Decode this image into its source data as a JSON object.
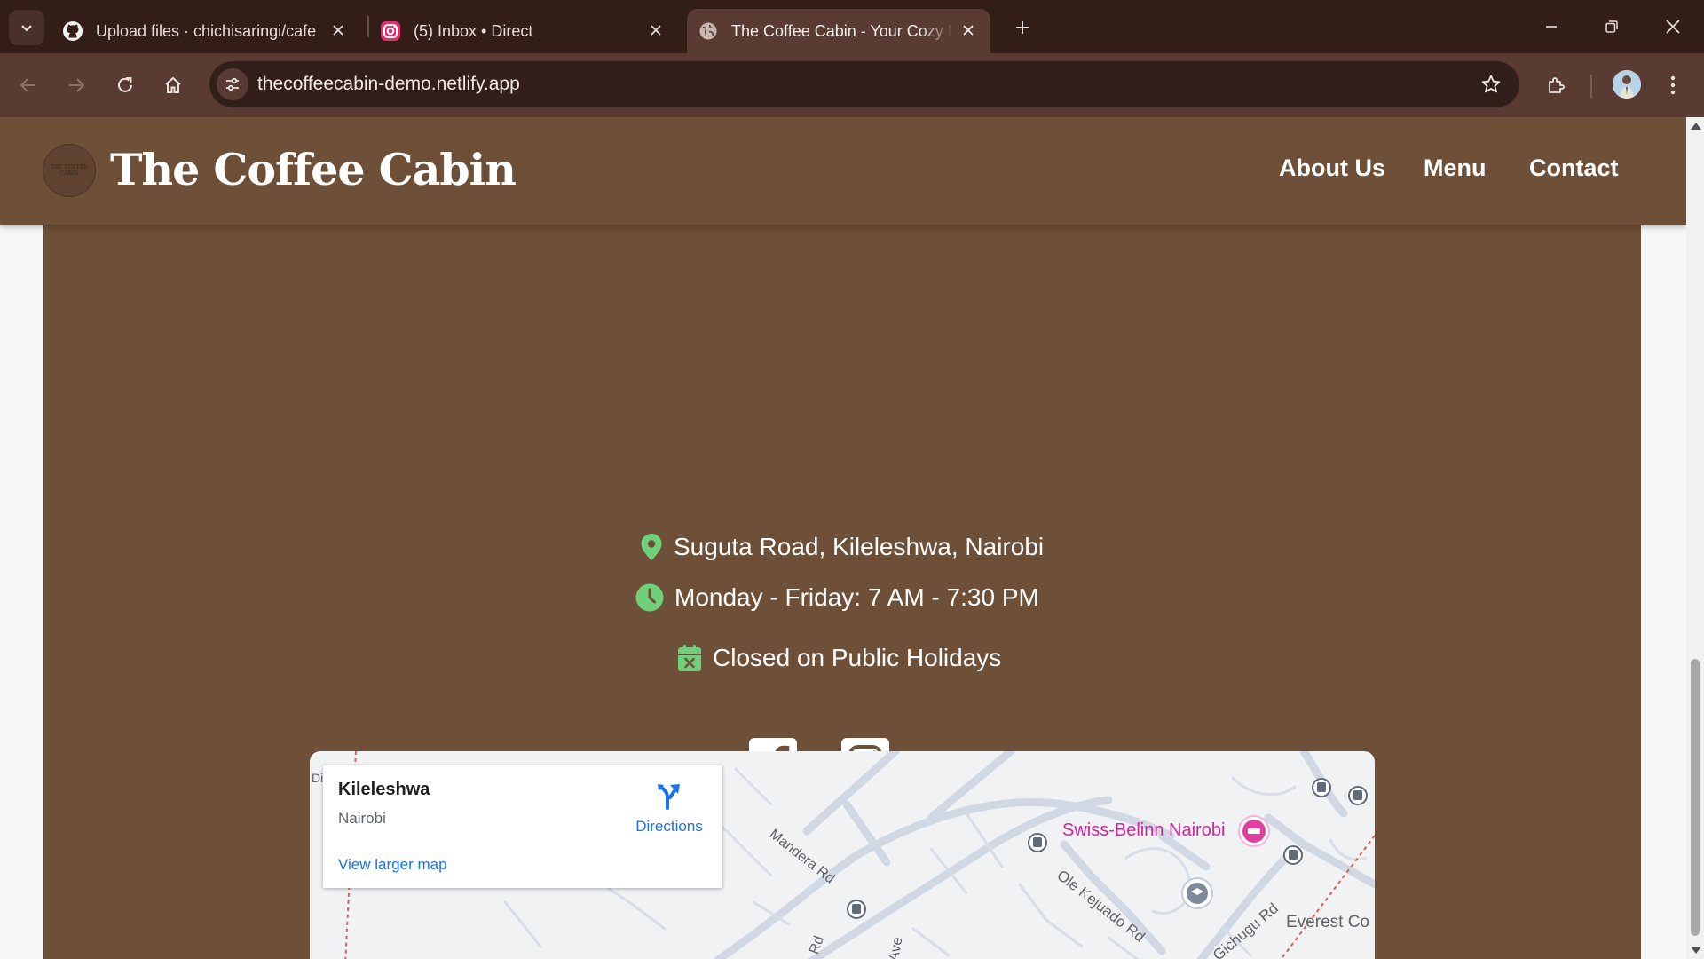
{
  "browser": {
    "tabs": [
      {
        "title": "Upload files · chichisaringi/cafe",
        "icon": "github-icon"
      },
      {
        "title": "(5) Inbox • Direct",
        "icon": "instagram-icon"
      },
      {
        "title": "The Coffee Cabin - Your Cozy Retreat",
        "icon": "globe-icon",
        "active": true
      }
    ],
    "url": "thecoffeecabin-demo.netlify.app"
  },
  "site": {
    "brand": "The Coffee Cabin",
    "logo_text": "THE COFFEE CABIN",
    "nav": {
      "about": "About Us",
      "menu": "Menu",
      "contact": "Contact"
    }
  },
  "contact": {
    "address": "Suguta Road, Kileleshwa, Nairobi",
    "hours": "Monday - Friday: 7 AM - 7:30 PM",
    "holidays": "Closed on Public Holidays"
  },
  "colors": {
    "header_bg": "#6e4f37",
    "accent_green": "#6fcf7a",
    "map_link": "#1a73e8",
    "poi_pink": "#d1259c"
  },
  "map": {
    "place_name": "Kileleshwa",
    "place_sub": "Nairobi",
    "directions_label": "Directions",
    "larger_map_label": "View larger map",
    "labels": {
      "mandera": "Mandera Rd",
      "ole_kejuado": "Ole Kejuado Rd",
      "gichugu": "Gichugu Rd",
      "everest": "Everest Co",
      "rd_bottom": "Rd",
      "ave_bottom": "Ave",
      "edge_left": "Di"
    },
    "poi": "Swiss-Belinn Nairobi"
  }
}
